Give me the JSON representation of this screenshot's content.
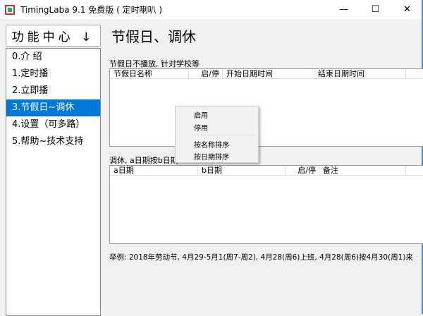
{
  "window": {
    "title": "TimingLaba 9.1 免费版 ( 定时喇叭 )",
    "minimize": "—",
    "maximize": "☐",
    "close": "✕"
  },
  "sidebar": {
    "header": "功能中心 ↓",
    "items": [
      {
        "label": "0.介 绍"
      },
      {
        "label": "1.定时播"
      },
      {
        "label": "2.立即播"
      },
      {
        "label": "3.节假日~调休",
        "selected": true
      },
      {
        "label": "4.设置（可多路）"
      },
      {
        "label": "5.帮助~技术支持"
      }
    ]
  },
  "main": {
    "title": "节假日、调休",
    "holiday": {
      "label": "节假日不播放, 针对学校等",
      "columns": [
        "节假日名称",
        "启/停",
        "开始日期时间",
        "结束日期时间",
        ""
      ]
    },
    "swap": {
      "label": "调休, a日期按b日期",
      "columns": [
        "a日期",
        "b日期",
        "启/停",
        "备注",
        ""
      ]
    },
    "example": "举例:  2018年劳动节, 4月29-5月1(周7-周2), 4月28(周6)上班, 4月28(周6)按4月30(周1)来"
  },
  "context_menu": {
    "items": [
      "启用",
      "停用",
      "按名称排序",
      "按日期排序"
    ]
  },
  "colors": {
    "selection": "#0078d7"
  }
}
